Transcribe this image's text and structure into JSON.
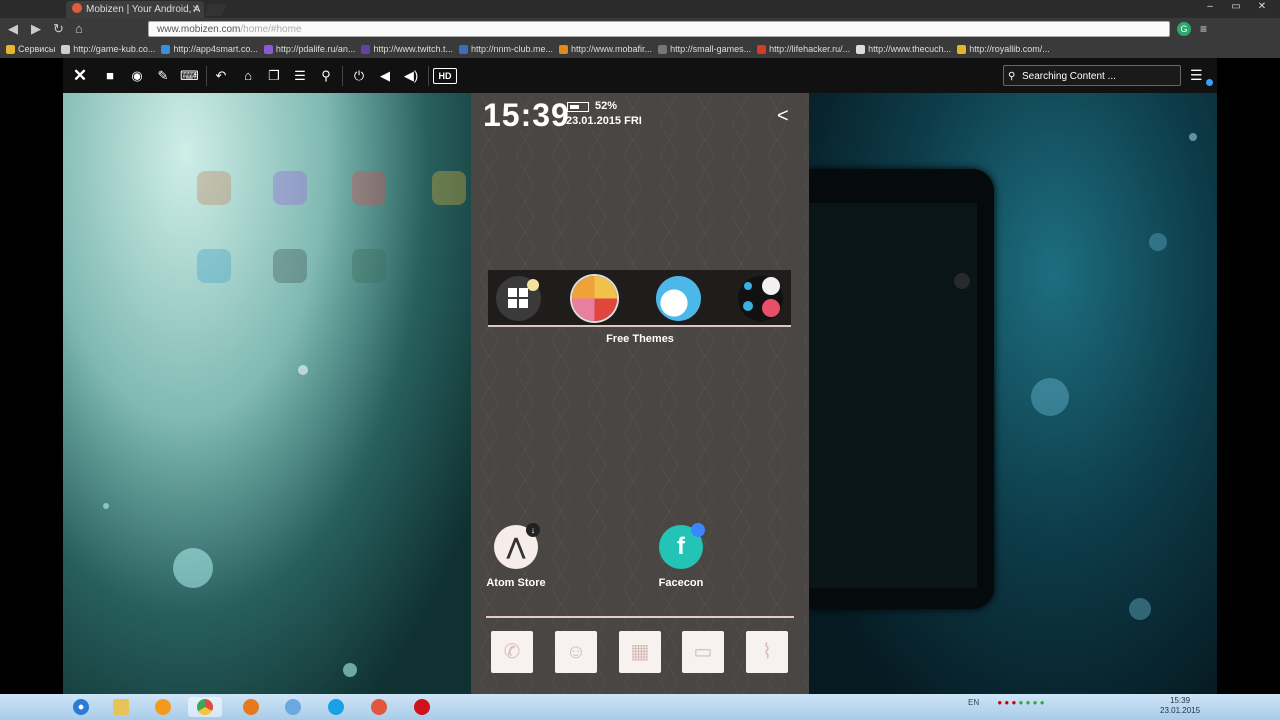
{
  "browser": {
    "tab_title": "Mobizen | Your Android, A",
    "url_host": "www.mobizen.com",
    "url_path": "/home/#home",
    "window_controls": [
      "–",
      "▭",
      "✕"
    ],
    "bookmarks": [
      {
        "label": "Сервисы",
        "color": "#e7b52f"
      },
      {
        "label": "http://game-kub.co...",
        "color": "#cfcfcf"
      },
      {
        "label": "http://app4smart.co...",
        "color": "#3a8fd8"
      },
      {
        "label": "http://pdalife.ru/an...",
        "color": "#8a5bd0"
      },
      {
        "label": "http://www.twitch.t...",
        "color": "#6441a5"
      },
      {
        "label": "http://nnm-club.me...",
        "color": "#3a6fc0"
      },
      {
        "label": "http://www.mobafir...",
        "color": "#e08a1e"
      },
      {
        "label": "http://small-games...",
        "color": "#777777"
      },
      {
        "label": "http://lifehacker.ru/...",
        "color": "#d83a2a"
      },
      {
        "label": "http://www.thecuch...",
        "color": "#dddddd"
      },
      {
        "label": "http://royallib.com/...",
        "color": "#e8b42a"
      }
    ]
  },
  "mobizen": {
    "search_placeholder": "Searching Content ...",
    "hd_label": "HD",
    "icons": [
      "close-icon",
      "video-icon",
      "camera-icon",
      "pen-icon",
      "keyboard-icon",
      "back-icon",
      "home-icon",
      "recent-apps-icon",
      "menu-icon",
      "search-icon",
      "power-icon",
      "volume-down-icon",
      "volume-up-icon"
    ]
  },
  "phone": {
    "time": "15:39",
    "battery": "52%",
    "date": "23.01.2015  FRI",
    "folder_label": "Free Themes",
    "apps": [
      {
        "label": "Atom Store"
      },
      {
        "label": "Facecon"
      }
    ],
    "dock": [
      "phone-icon",
      "contacts-icon",
      "apps-icon",
      "messages-icon",
      "browser-icon"
    ]
  },
  "taskbar": {
    "lang": "EN",
    "time": "15:39",
    "date": "23.01.2015"
  }
}
